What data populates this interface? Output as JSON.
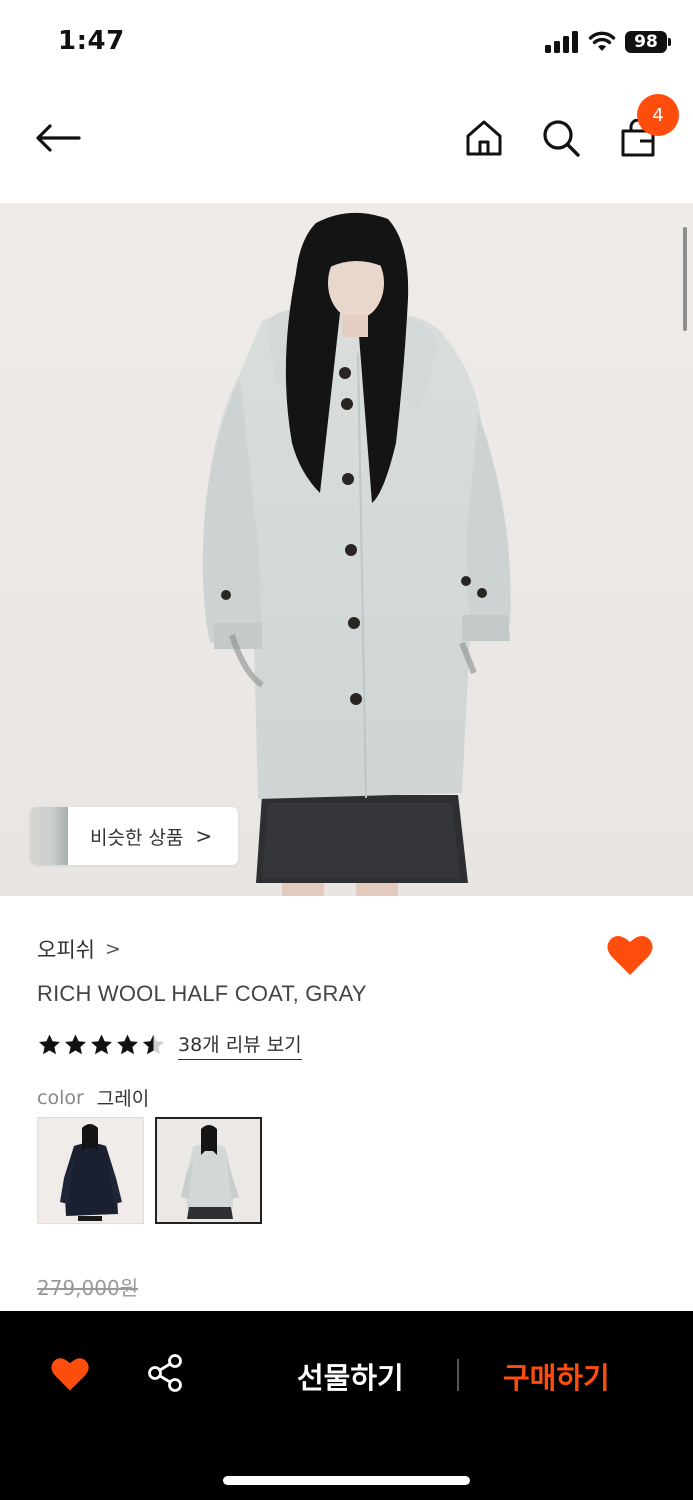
{
  "status_bar": {
    "time": "1:47",
    "battery": "98",
    "icons": [
      "signal-icon",
      "wifi-icon",
      "battery-icon"
    ]
  },
  "header": {
    "icons": [
      "back-arrow-icon",
      "home-icon",
      "search-icon",
      "shopping-bag-icon"
    ],
    "cart_count": "4"
  },
  "hero": {
    "similar_products_label": "비슷한 상품",
    "similar_products_chevron": ">"
  },
  "product": {
    "brand": "오피쉬",
    "brand_chevron": ">",
    "name": "RICH WOOL HALF COAT, GRAY",
    "rating": 4.5,
    "rating_max": 5,
    "review_link": "38개 리뷰 보기",
    "color_label": "color",
    "color_value": "그레이",
    "swatches": [
      "navy",
      "gray"
    ],
    "selected_swatch": "gray",
    "original_price": "279,000원"
  },
  "bottom_bar": {
    "gift_label": "선물하기",
    "buy_label": "구매하기",
    "icons": [
      "heart-icon",
      "share-icon"
    ]
  },
  "colors": {
    "accent": "#ff4d0d",
    "bottom_bar_bg": "#000000",
    "text_primary": "#222222",
    "text_muted": "#999999"
  }
}
